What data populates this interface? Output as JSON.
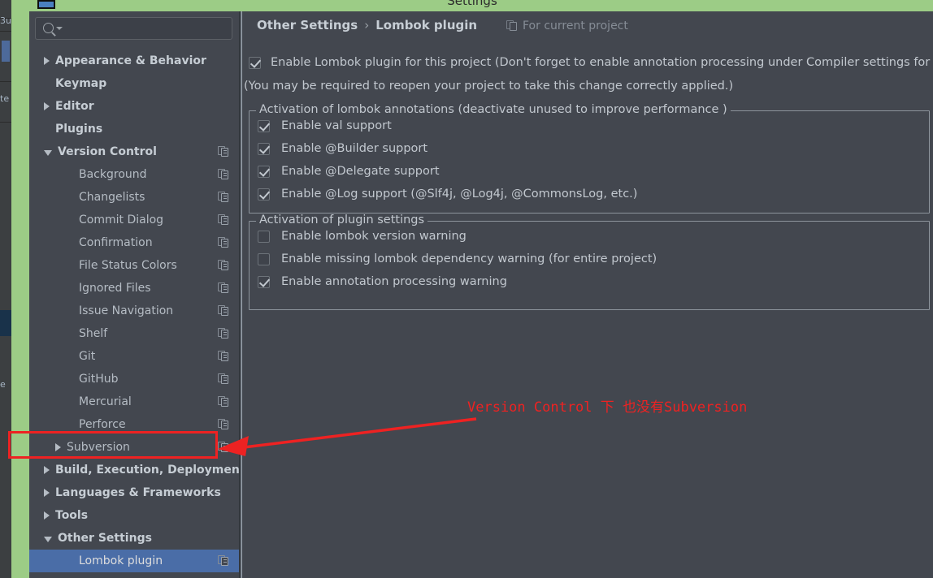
{
  "window": {
    "title": "Settings",
    "icon": "window-icon"
  },
  "sidebar": {
    "search": {
      "value": "",
      "placeholder": "",
      "icon": "search-icon"
    },
    "items": [
      {
        "label": "Appearance & Behavior",
        "arrow": "right",
        "indent": 0,
        "bold": true,
        "copy_icon": false,
        "selected": false
      },
      {
        "label": "Keymap",
        "arrow": "none",
        "indent": 0,
        "bold": true,
        "copy_icon": false,
        "selected": false
      },
      {
        "label": "Editor",
        "arrow": "right",
        "indent": 0,
        "bold": true,
        "copy_icon": false,
        "selected": false
      },
      {
        "label": "Plugins",
        "arrow": "none",
        "indent": 0,
        "bold": true,
        "copy_icon": false,
        "selected": false
      },
      {
        "label": "Version Control",
        "arrow": "down",
        "indent": 0,
        "bold": true,
        "copy_icon": true,
        "selected": false
      },
      {
        "label": "Background",
        "arrow": "none",
        "indent": 1,
        "bold": false,
        "copy_icon": true,
        "selected": false
      },
      {
        "label": "Changelists",
        "arrow": "none",
        "indent": 1,
        "bold": false,
        "copy_icon": true,
        "selected": false
      },
      {
        "label": "Commit Dialog",
        "arrow": "none",
        "indent": 1,
        "bold": false,
        "copy_icon": true,
        "selected": false
      },
      {
        "label": "Confirmation",
        "arrow": "none",
        "indent": 1,
        "bold": false,
        "copy_icon": true,
        "selected": false
      },
      {
        "label": "File Status Colors",
        "arrow": "none",
        "indent": 1,
        "bold": false,
        "copy_icon": true,
        "selected": false
      },
      {
        "label": "Ignored Files",
        "arrow": "none",
        "indent": 1,
        "bold": false,
        "copy_icon": true,
        "selected": false
      },
      {
        "label": "Issue Navigation",
        "arrow": "none",
        "indent": 1,
        "bold": false,
        "copy_icon": true,
        "selected": false
      },
      {
        "label": "Shelf",
        "arrow": "none",
        "indent": 1,
        "bold": false,
        "copy_icon": true,
        "selected": false
      },
      {
        "label": "Git",
        "arrow": "none",
        "indent": 1,
        "bold": false,
        "copy_icon": true,
        "selected": false
      },
      {
        "label": "GitHub",
        "arrow": "none",
        "indent": 1,
        "bold": false,
        "copy_icon": true,
        "selected": false
      },
      {
        "label": "Mercurial",
        "arrow": "none",
        "indent": 1,
        "bold": false,
        "copy_icon": true,
        "selected": false
      },
      {
        "label": "Perforce",
        "arrow": "none",
        "indent": 1,
        "bold": false,
        "copy_icon": true,
        "selected": false
      },
      {
        "label": "Subversion",
        "arrow": "right",
        "indent": 2,
        "bold": false,
        "copy_icon": true,
        "selected": false
      },
      {
        "label": "Build, Execution, Deployment",
        "arrow": "right",
        "indent": 0,
        "bold": true,
        "copy_icon": false,
        "selected": false
      },
      {
        "label": "Languages & Frameworks",
        "arrow": "right",
        "indent": 0,
        "bold": true,
        "copy_icon": false,
        "selected": false
      },
      {
        "label": "Tools",
        "arrow": "right",
        "indent": 0,
        "bold": true,
        "copy_icon": false,
        "selected": false
      },
      {
        "label": "Other Settings",
        "arrow": "down",
        "indent": 0,
        "bold": true,
        "copy_icon": false,
        "selected": false
      },
      {
        "label": "Lombok plugin",
        "arrow": "none",
        "indent": 1,
        "bold": false,
        "copy_icon": true,
        "selected": true
      }
    ],
    "selected_color": "#4a6da7"
  },
  "main": {
    "breadcrumb": {
      "parent": "Other Settings",
      "separator": "›",
      "current": "Lombok plugin"
    },
    "project_scope": {
      "label": "For current project",
      "icon": "copy-icon"
    },
    "enable_plugin": {
      "checked": true,
      "label": "Enable Lombok plugin for this project (Don't forget to enable annotation processing under Compiler settings for"
    },
    "reopen_note": "(You may be required to reopen your project to take this change correctly applied.)",
    "groups": [
      {
        "legend": "Activation of lombok annotations (deactivate unused to improve performance )",
        "rows": [
          {
            "label": "Enable val support",
            "checked": true
          },
          {
            "label": "Enable @Builder support",
            "checked": true
          },
          {
            "label": "Enable @Delegate support",
            "checked": true
          },
          {
            "label": "Enable @Log support (@Slf4j, @Log4j, @CommonsLog, etc.)",
            "checked": true
          }
        ]
      },
      {
        "legend": "Activation of plugin settings",
        "rows": [
          {
            "label": "Enable lombok version warning",
            "checked": false
          },
          {
            "label": "Enable missing lombok dependency warning (for entire project)",
            "checked": false
          },
          {
            "label": "Enable annotation processing warning",
            "checked": true
          }
        ]
      }
    ]
  },
  "annotation": {
    "text": "Version Control 下 也没有Subversion",
    "color": "#ee2222",
    "box_target": "Subversion",
    "arrow": "points-left-to-subversion"
  },
  "colors": {
    "dialog_bg": "#43474f",
    "highlight_frame": "#9ccc86",
    "selection": "#4a6da7",
    "annotation_red": "#ee2222",
    "text": "#c2c8cf"
  },
  "background_ide": {
    "fragments": [
      "3u",
      "te",
      "e"
    ]
  }
}
